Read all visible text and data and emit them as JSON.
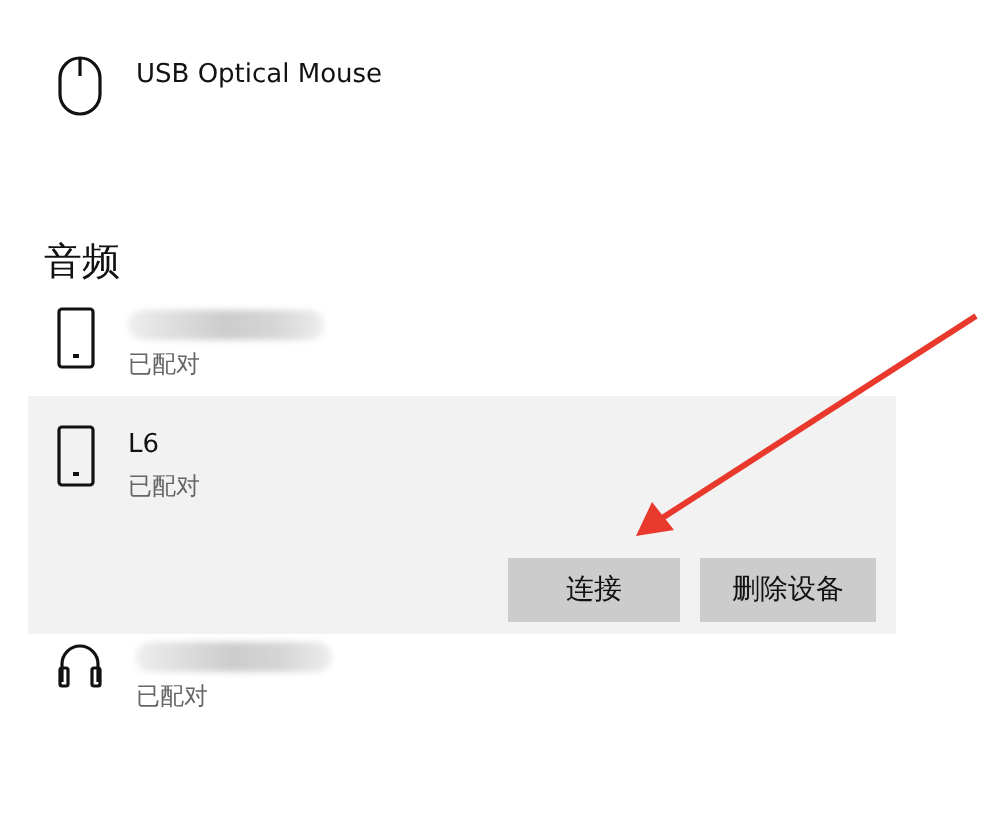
{
  "sections": [
    {
      "devices": [
        {
          "kind": "mouse",
          "name": "USB Optical Mouse",
          "name_blurred": false,
          "selected": false
        }
      ]
    },
    {
      "heading": "音频",
      "devices": [
        {
          "kind": "phone",
          "name_blurred": true,
          "status": "已配对",
          "selected": false
        },
        {
          "kind": "phone",
          "name": "L6",
          "name_blurred": false,
          "status": "已配对",
          "selected": true,
          "buttons": [
            "连接",
            "删除设备"
          ]
        },
        {
          "kind": "headphones",
          "name_blurred": true,
          "status": "已配对",
          "selected": false
        }
      ]
    }
  ]
}
